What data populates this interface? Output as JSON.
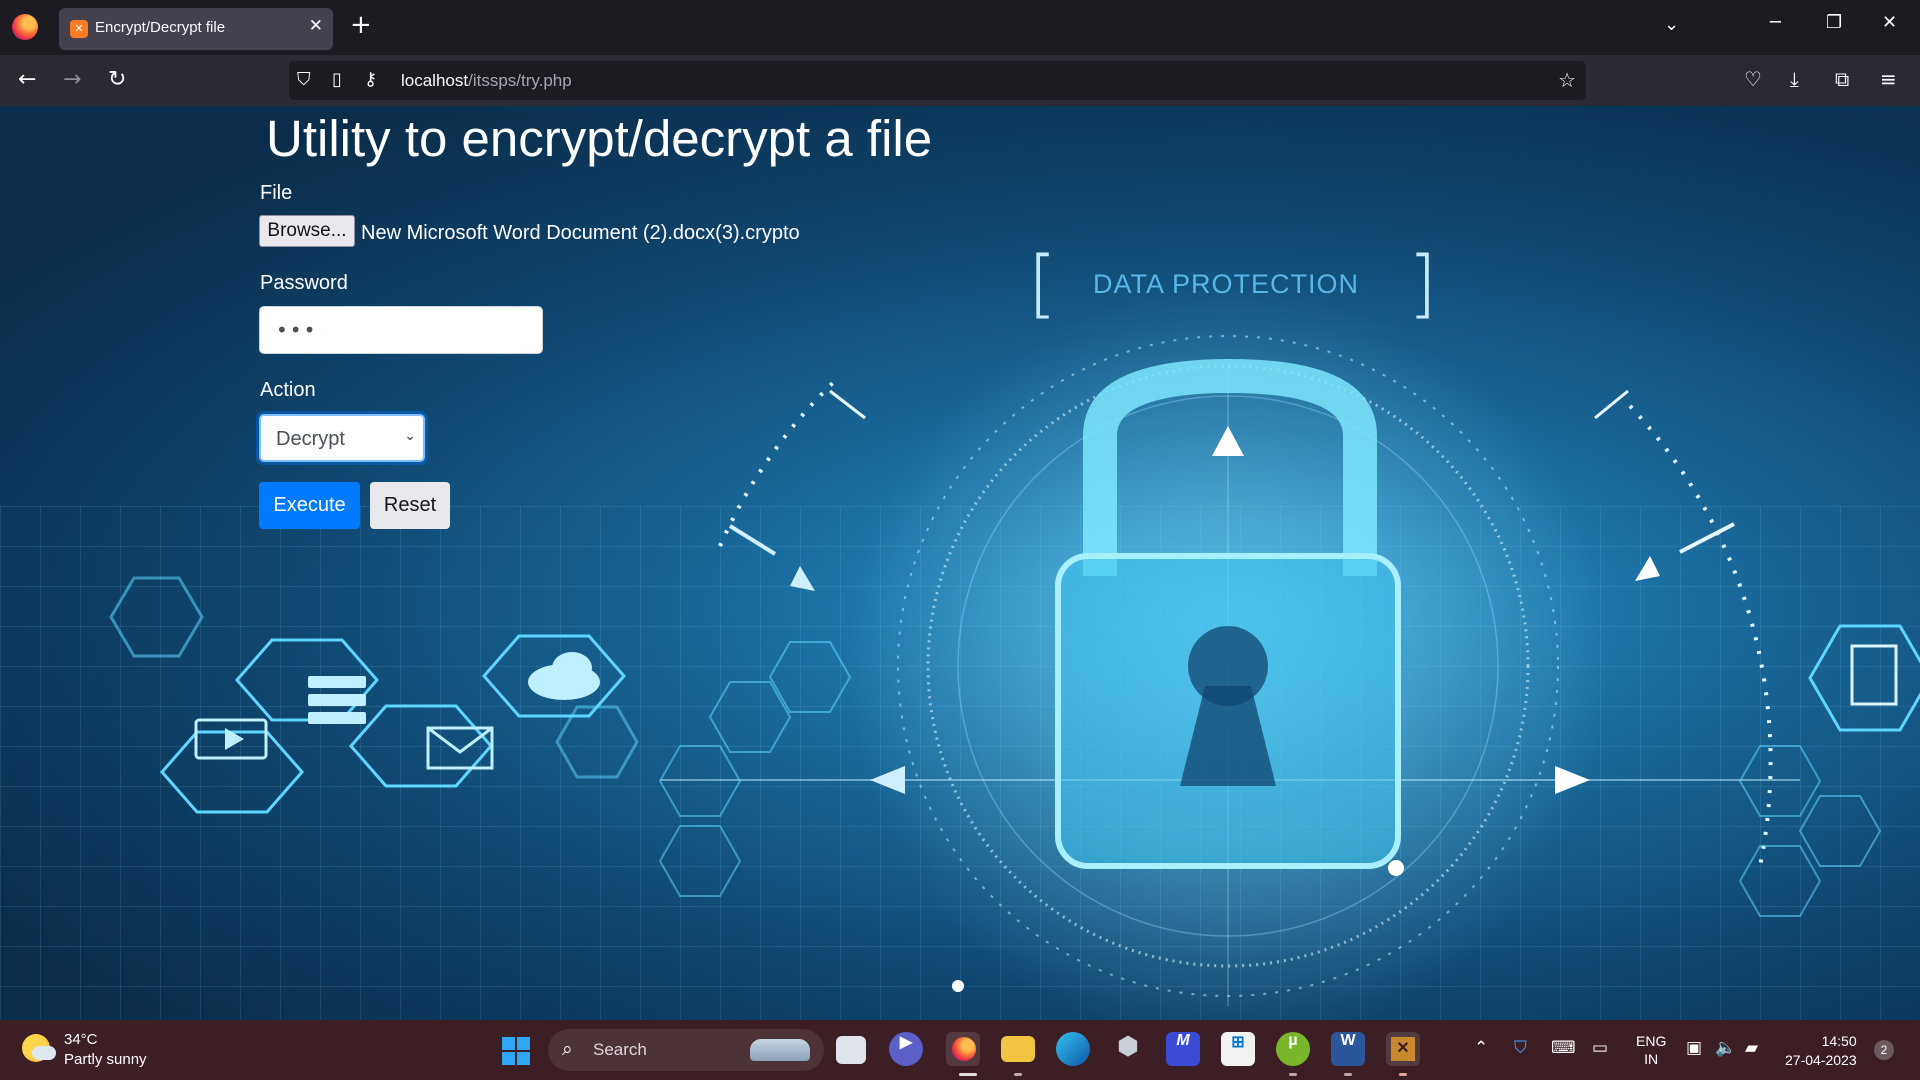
{
  "browser": {
    "tab_title": "Encrypt/Decrypt file",
    "tab_close": "✕",
    "new_tab": "+",
    "url_host": "localhost",
    "url_path": "/itssps/try.php",
    "icons": [
      "firefox-logo",
      "back",
      "forward",
      "reload",
      "shield",
      "page",
      "key",
      "bookmark-star",
      "pocket",
      "download",
      "extensions",
      "menu"
    ]
  },
  "form": {
    "heading": "Utility to encrypt/decrypt a file",
    "file_label": "File",
    "browse_label": "Browse...",
    "file_name": "New Microsoft Word Document (2).docx(3).crypto",
    "password_label": "Password",
    "password_value": "•••",
    "action_label": "Action",
    "action_selected": "Decrypt",
    "execute_label": "Execute",
    "reset_label": "Reset"
  },
  "background": {
    "caption": "DATA PROTECTION",
    "bracket_left": "[",
    "bracket_right": "]",
    "colors": {
      "accent": "#007bff",
      "deep": "#0a2d4b",
      "glow": "#2d9ad0"
    }
  },
  "taskbar": {
    "weather_temp": "34°C",
    "weather_condition": "Partly sunny",
    "search_label": "Search",
    "lang_line1": "ENG",
    "lang_line2": "IN",
    "time": "14:50",
    "date": "27-04-2023",
    "notification_count": "2",
    "apps": [
      "windows-start",
      "search",
      "task-view",
      "teams-chat",
      "firefox",
      "file-explorer",
      "edge",
      "app-hexagon",
      "app-blue",
      "microsoft-store",
      "utorrent",
      "word",
      "xampp"
    ]
  }
}
